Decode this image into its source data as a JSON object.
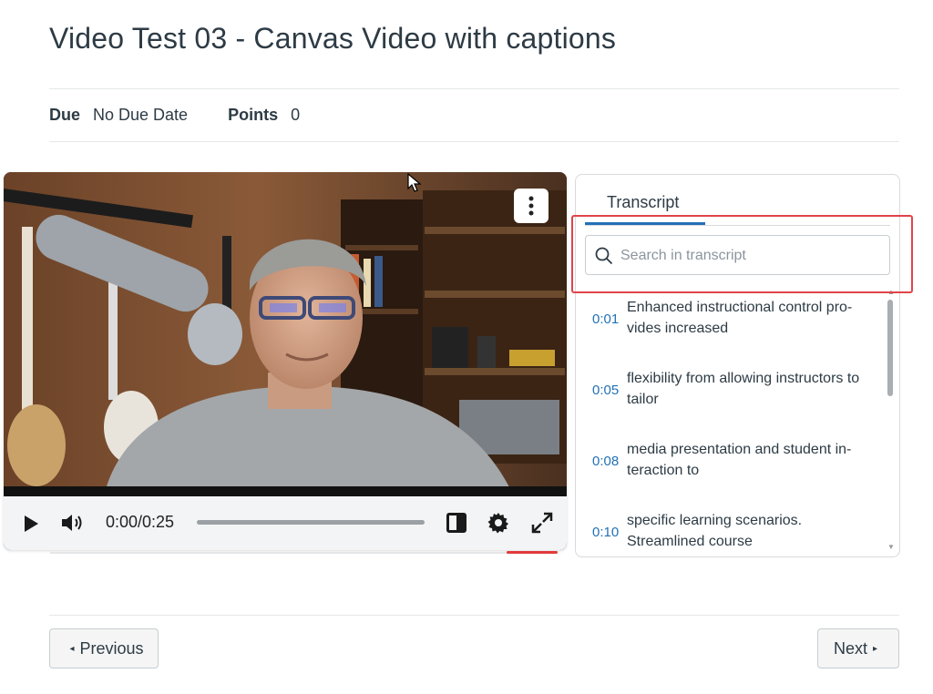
{
  "page": {
    "title": "Video Test 03 - Canvas Video with captions"
  },
  "meta": {
    "due_label": "Due",
    "due_value": "No Due Date",
    "points_label": "Points",
    "points_value": "0"
  },
  "player": {
    "time": "0:00/0:25",
    "progress": 0,
    "icons": [
      "play-icon",
      "volume-icon",
      "sidebar-toggle-icon",
      "gear-icon",
      "fullscreen-icon",
      "kebab-menu-icon"
    ]
  },
  "transcript": {
    "tab_label": "Transcript",
    "search_placeholder": "Search in transcript",
    "search_value": "",
    "cues": [
      {
        "time": "0:01",
        "text": "Enhanced instructional control pro-vides increased"
      },
      {
        "time": "0:05",
        "text": "flexibility from allowing instructors to tailor"
      },
      {
        "time": "0:08",
        "text": "media presentation and student in-teraction to"
      },
      {
        "time": "0:10",
        "text": "specific learning scenarios. Streamlined course"
      }
    ]
  },
  "nav": {
    "previous_label": "Previous",
    "next_label": "Next"
  },
  "colors": {
    "accent": "#2271b5",
    "highlight": "#e0444a",
    "text": "#2d3b45"
  }
}
